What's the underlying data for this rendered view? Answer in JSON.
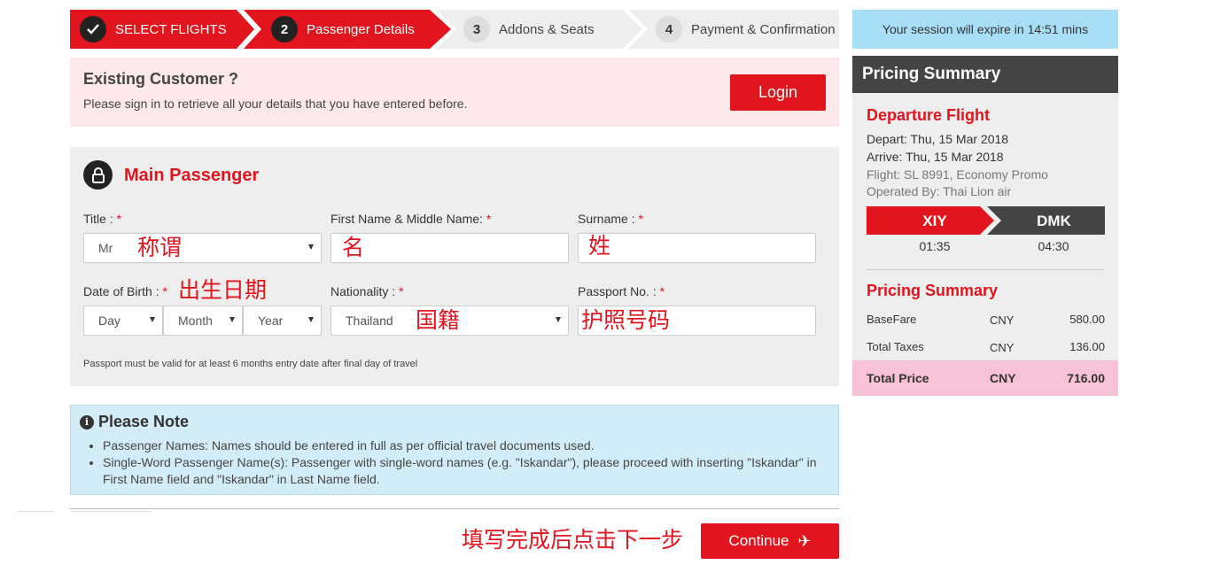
{
  "steps": [
    {
      "num": "",
      "label": "SELECT FLIGHTS"
    },
    {
      "num": "2",
      "label": "Passenger Details"
    },
    {
      "num": "3",
      "label": "Addons & Seats"
    },
    {
      "num": "4",
      "label": "Payment & Confirmation"
    }
  ],
  "existing_customer": {
    "title": "Existing Customer ?",
    "text": "Please sign in to retrieve all your details that you have entered before.",
    "login_label": "Login"
  },
  "main_passenger": {
    "title": "Main Passenger",
    "title_label": "Title :",
    "title_value": "Mr",
    "first_name_label": "First Name & Middle Name:",
    "surname_label": "Surname :",
    "dob_label": "Date of Birth :",
    "dob_day": "Day",
    "dob_month": "Month",
    "dob_year": "Year",
    "nationality_label": "Nationality :",
    "nationality_value": "Thailand",
    "passport_label": "Passport No. :",
    "required_mark": "*",
    "hint": "Passport must be valid for at least 6 months entry date after final day of travel"
  },
  "annotations": {
    "title": "称谓",
    "first_name": "名",
    "surname": "姓",
    "dob": "出生日期",
    "nationality": "国籍",
    "passport": "护照号码",
    "continue": "填写完成后点击下一步"
  },
  "note": {
    "title": "Please Note",
    "items": [
      "Passenger Names: Names should be entered in full as per official travel documents used.",
      "Single-Word Passenger Name(s): Passenger with single-word names (e.g. \"Iskandar\"), please proceed with inserting \"Iskandar\" in First Name field and \"Iskandar\" in Last Name field."
    ]
  },
  "continue_label": "Continue",
  "session_text": "Your session will expire in 14:51 mins",
  "pricing": {
    "header": "Pricing Summary",
    "departure_title": "Departure Flight",
    "depart": "Depart: Thu, 15 Mar 2018",
    "arrive": "Arrive: Thu, 15 Mar 2018",
    "flight": "Flight: SL 8991, Economy Promo",
    "operated": "Operated By: Thai Lion air",
    "origin": "XIY",
    "destination": "DMK",
    "depart_time": "01:35",
    "arrive_time": "04:30",
    "summary_title": "Pricing Summary",
    "rows": [
      {
        "label": "BaseFare",
        "currency": "CNY",
        "amount": "580.00"
      },
      {
        "label": "Total Taxes",
        "currency": "CNY",
        "amount": "136.00"
      }
    ],
    "total": {
      "label": "Total Price",
      "currency": "CNY",
      "amount": "716.00"
    }
  },
  "colors": {
    "brand_red": "#e2141d",
    "step_inactive": "#eeeeee",
    "session_bg": "#a9def7",
    "note_bg": "#d3edf8",
    "total_bg": "#f7c1d6"
  }
}
